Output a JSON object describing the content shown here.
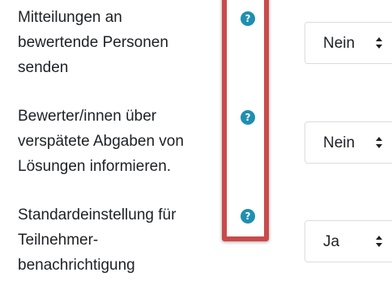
{
  "settings": [
    {
      "label_lines": [
        "Mitteilungen an",
        "bewertende Personen",
        "senden"
      ],
      "help_icon": "question-circle-icon",
      "select_value": "Nein"
    },
    {
      "label_lines": [
        "Bewerter/innen über",
        "verspätete Abgaben von",
        "Lösungen informieren."
      ],
      "help_icon": "question-circle-icon",
      "select_value": "Nein"
    },
    {
      "label_lines": [
        "Standardeinstellung für",
        "Teilnehmer-",
        "benachrichtigung"
      ],
      "help_icon": "question-circle-icon",
      "select_value": "Ja"
    }
  ],
  "help_glyph": "?",
  "colors": {
    "help_icon": "#1f8fb0",
    "highlight_border": "#c94a4a",
    "text": "#1d2125",
    "select_border": "#d9dcde"
  }
}
